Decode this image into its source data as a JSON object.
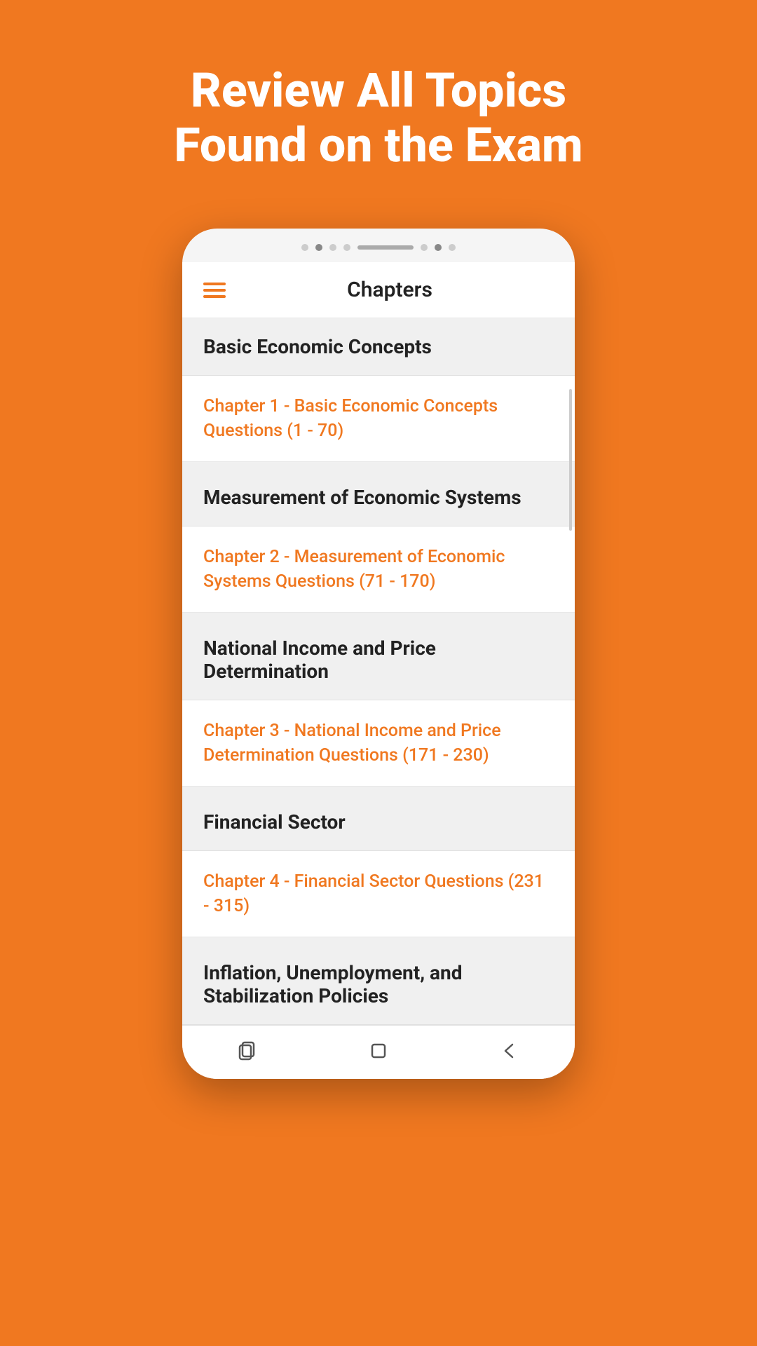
{
  "header": {
    "line1": "Review All Topics",
    "line2": "Found on the Exam"
  },
  "app": {
    "title": "Chapters",
    "accent_color": "#F07820"
  },
  "chapters": [
    {
      "section": "Basic Economic Concepts",
      "link": "Chapter 1 - Basic Economic Concepts Questions (1 - 70)"
    },
    {
      "section": "Measurement of Economic Systems",
      "link": "Chapter 2 - Measurement of Economic Systems Questions (71 - 170)"
    },
    {
      "section": "National Income and Price Determination",
      "link": "Chapter 3 - National Income and Price Determination Questions (171 - 230)"
    },
    {
      "section": "Financial Sector",
      "link": "Chapter 4 - Financial Sector Questions (231 - 315)"
    },
    {
      "section": "Inflation, Unemployment, and Stabilization Policies",
      "link": null
    }
  ],
  "nav": {
    "recents": "recents",
    "home": "home",
    "back": "back"
  }
}
